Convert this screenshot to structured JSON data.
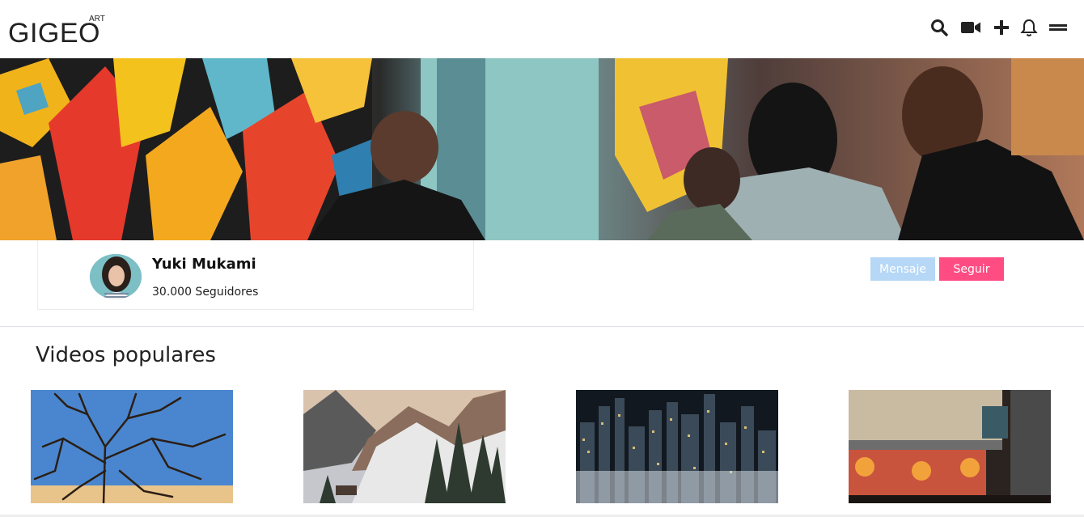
{
  "brand": {
    "name": "GIGEO",
    "sup": "ART"
  },
  "nav": {
    "icons": [
      "search-icon",
      "video-camera-icon",
      "plus-icon",
      "bell-icon",
      "menu-icon"
    ]
  },
  "profile": {
    "name": "Yuki Mukami",
    "followers": "30.000 Seguidores"
  },
  "actions": {
    "message_label": "Mensaje",
    "follow_label": "Seguir"
  },
  "colors": {
    "message_button": "#b6d8f6",
    "follow_button": "#ff4d84"
  },
  "popular": {
    "title": "Videos populares"
  }
}
